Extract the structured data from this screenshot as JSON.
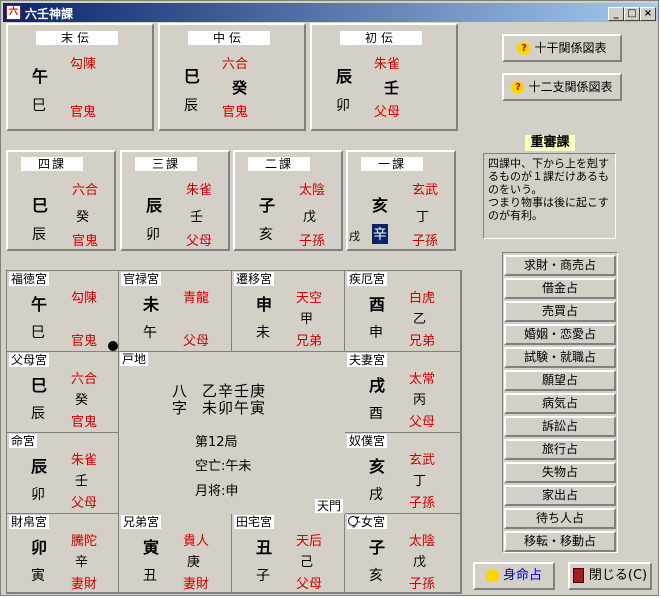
{
  "window": {
    "title": "六壬神課",
    "icon_text": "六"
  },
  "sanden": [
    {
      "header": "末伝",
      "kanshi": "午",
      "base": "巳",
      "general": "勾陳",
      "relative": "官鬼",
      "stem": ""
    },
    {
      "header": "中伝",
      "kanshi": "巳",
      "base": "辰",
      "general": "六合",
      "relative": "官鬼",
      "stem": "癸"
    },
    {
      "header": "初伝",
      "kanshi": "辰",
      "base": "卯",
      "general": "朱雀",
      "relative": "父母",
      "stem": "壬"
    }
  ],
  "right_buttons": {
    "kan_rel": "十干関係図表",
    "shi_rel": "十二支関係図表"
  },
  "yonka": [
    {
      "header": "四課",
      "upper": "巳",
      "lower": "辰",
      "general": "六合",
      "stem": "癸",
      "relative": "官鬼"
    },
    {
      "header": "三課",
      "upper": "辰",
      "lower": "卯",
      "general": "朱雀",
      "stem": "壬",
      "relative": "父母"
    },
    {
      "header": "二課",
      "upper": "子",
      "lower": "亥",
      "general": "太陰",
      "stem": "戊",
      "relative": "子孫"
    },
    {
      "header": "一課",
      "upper": "亥",
      "lower": "辛",
      "general": "玄武",
      "stem": "丁",
      "relative": "子孫",
      "prefix": "戌"
    }
  ],
  "method": {
    "title": "重審課",
    "description": "四課中、下から上を剋するものが１課だけあるものをいう。\nつまり物事は後に起こすのが有利。"
  },
  "palaces": [
    {
      "name": "福徳宮",
      "kanshi": "午",
      "base": "巳",
      "general": "勾陳",
      "relative": "官鬼",
      "stem": ""
    },
    {
      "name": "官禄宮",
      "kanshi": "未",
      "base": "午",
      "general": "青龍",
      "relative": "父母",
      "stem": ""
    },
    {
      "name": "遷移宮",
      "kanshi": "申",
      "base": "未",
      "general": "天空",
      "relative": "兄弟",
      "stem": "甲"
    },
    {
      "name": "疾厄宮",
      "kanshi": "酉",
      "base": "申",
      "general": "白虎",
      "relative": "兄弟",
      "stem": "乙"
    },
    {
      "name": "父母宮",
      "kanshi": "巳",
      "base": "辰",
      "general": "六合",
      "relative": "官鬼",
      "stem": "癸"
    },
    {
      "name": "夫妻宮",
      "kanshi": "戌",
      "base": "酉",
      "general": "太常",
      "relative": "父母",
      "stem": "丙"
    },
    {
      "name": "命宮",
      "kanshi": "辰",
      "base": "卯",
      "general": "朱雀",
      "relative": "父母",
      "stem": "壬"
    },
    {
      "name": "奴僕宮",
      "kanshi": "亥",
      "base": "戌",
      "general": "玄武",
      "relative": "子孫",
      "stem": "丁"
    },
    {
      "name": "財帛宮",
      "kanshi": "卯",
      "base": "寅",
      "general": "騰陀",
      "relative": "妻財",
      "stem": "辛"
    },
    {
      "name": "兄弟宮",
      "kanshi": "寅",
      "base": "丑",
      "general": "貴人",
      "relative": "妻財",
      "stem": "庚"
    },
    {
      "name": "田宅宮",
      "kanshi": "丑",
      "base": "子",
      "general": "天后",
      "relative": "父母",
      "stem": "己"
    },
    {
      "name": "子女宮",
      "kanshi": "子",
      "base": "亥",
      "general": "太陰",
      "relative": "子孫",
      "stem": "戊"
    }
  ],
  "center": {
    "hachi": "八",
    "ji": "字",
    "stems_row": "乙辛壬庚",
    "branches_row": "未卯午寅",
    "koku": "第12局",
    "kubo": "空亡:午未",
    "gessho": "月将:申",
    "corner_tl": "戸地",
    "corner_br": "天門"
  },
  "menu": [
    "求財・商売占",
    "借金占",
    "売買占",
    "婚姻・恋愛占",
    "試験・就職占",
    "願望占",
    "病気占",
    "訴訟占",
    "旅行占",
    "失物占",
    "家出占",
    "待ち人占",
    "移転・移動占"
  ],
  "bottom_buttons": {
    "shinmei": "身命占",
    "close": "閉じる(C)"
  }
}
